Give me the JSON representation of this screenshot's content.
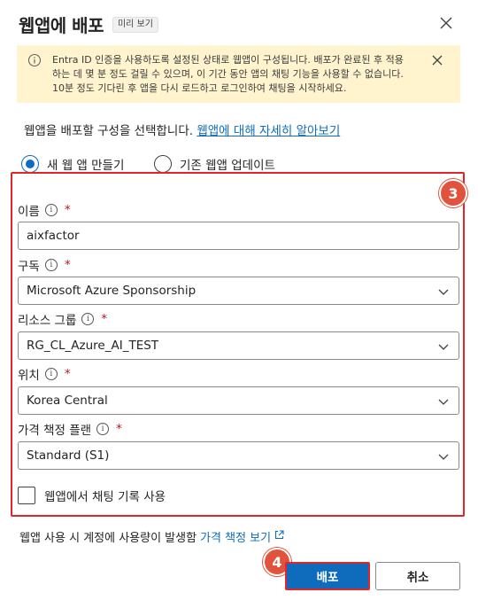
{
  "dialog": {
    "title": "웹앱에 배포",
    "preview_badge": "미리 보기",
    "close_icon": "close-icon"
  },
  "banner": {
    "icon": "info-icon",
    "message": "Entra ID 인증을 사용하도록 설정된 상태로 웹앱이 구성됩니다. 배포가 완료된 후 적용하는 데 몇 분 정도 걸릴 수 있으며, 이 기간 동안 앱의 채팅 기능을 사용할 수 없습니다. 10분 정도 기다린 후 앱을 다시 로드하고 로그인하여 채팅을 시작하세요.",
    "dismiss_icon": "close-icon"
  },
  "description": {
    "text": "웹앱을 배포할 구성을 선택합니다. ",
    "link": "웹앱에 대해 자세히 알아보기"
  },
  "mode": {
    "options": [
      {
        "label": "새 웹 앱 만들기",
        "selected": true
      },
      {
        "label": "기존 웹앱 업데이트",
        "selected": false
      }
    ]
  },
  "form": {
    "step_badge": "3",
    "name": {
      "label": "이름",
      "required_mark": "*",
      "value": "aixfactor"
    },
    "subscription": {
      "label": "구독",
      "required_mark": "*",
      "value": "Microsoft Azure Sponsorship"
    },
    "resource_group": {
      "label": "리소스 그룹",
      "required_mark": "*",
      "value": "RG_CL_Azure_AI_TEST"
    },
    "location": {
      "label": "위치",
      "required_mark": "*",
      "value": "Korea Central"
    },
    "pricing_plan": {
      "label": "가격 책정 플랜",
      "required_mark": "*",
      "value": "Standard (S1)"
    },
    "chat_history": {
      "label": "웹앱에서 채팅 기록 사용",
      "checked": false
    }
  },
  "footer": {
    "note": "웹앱 사용 시 계정에 사용량이 발생함 ",
    "pricing_link": "가격 책정 보기",
    "step_badge": "4",
    "deploy_label": "배포",
    "cancel_label": "취소"
  },
  "colors": {
    "accent": "#0f6cbd",
    "highlight_border": "#e0262a",
    "badge": "#e2533d",
    "banner_bg": "#fff4ce"
  }
}
